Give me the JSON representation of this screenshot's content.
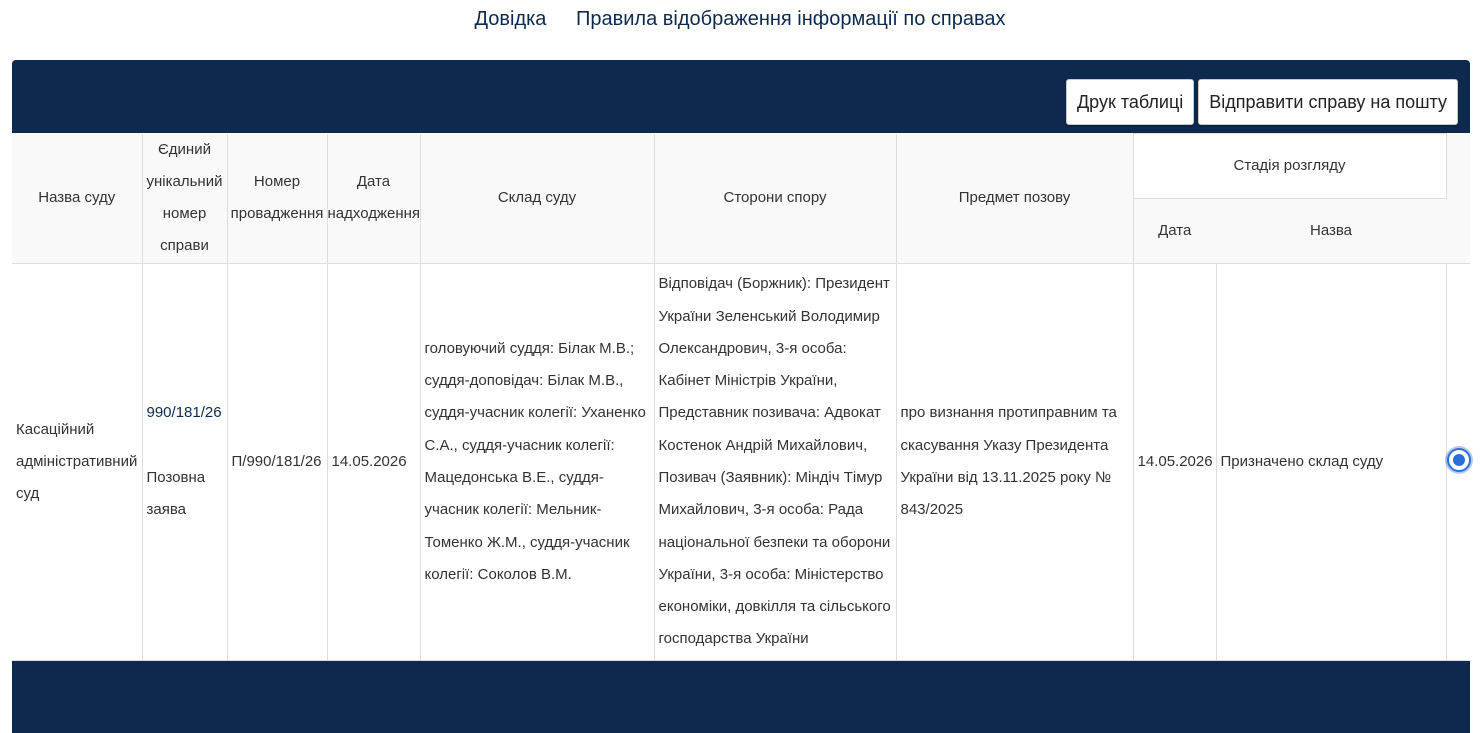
{
  "top_links": {
    "help": "Довідка",
    "rules": "Правила відображення інформації по справах"
  },
  "toolbar": {
    "print_label": "Друк таблиці",
    "email_label": "Відправити справу на пошту"
  },
  "table": {
    "headers": {
      "court_name": "Назва суду",
      "unique_number": "Єдиний унікальний номер справи",
      "proceeding_number": "Номер провадження",
      "received_date": "Дата надходження",
      "court_composition": "Склад суду",
      "parties": "Сторони спору",
      "subject": "Предмет позову",
      "stage": "Стадія розгляду",
      "stage_date": "Дата",
      "stage_name": "Назва"
    },
    "rows": [
      {
        "court_name": "Касаційний адміністративний суд",
        "unique_number": "990/181/26",
        "document_type": "Позовна заява",
        "proceeding_number": "П/990/181/26",
        "received_date": "14.05.2026",
        "court_composition": "головуючий суддя: Білак М.В.; суддя-доповідач: Білак М.В., суддя-учасник колегії: Уханенко С.А., суддя-учасник колегії: Мацедонська В.Е., суддя-учасник колегії: Мельник-Томенко Ж.М., суддя-учасник колегії: Соколов В.М.",
        "parties": "Відповідач (Боржник): Президент України Зеленський Володимир Олександрович, 3-я особа: Кабінет Міністрів України, Представник позивача: Адвокат Костенок Андрій Михайлович, Позивач (Заявник): Міндіч Тімур Михайлович, 3-я особа: Рада національної безпеки та оборони України, 3-я особа: Міністерство економіки, довкілля та сільського господарства України",
        "subject": "про визнання протиправним та скасування Указу Президента України від 13.11.2025 року № 843/2025",
        "stage_date": "14.05.2026",
        "stage_name": "Призначено склад суду",
        "selected": true
      }
    ]
  },
  "colors": {
    "header_bar": "#0d2a4e",
    "link": "#0d2a4e",
    "radio": "#2e6ed6"
  },
  "icons": {
    "row_select": "radio-selected-icon"
  }
}
